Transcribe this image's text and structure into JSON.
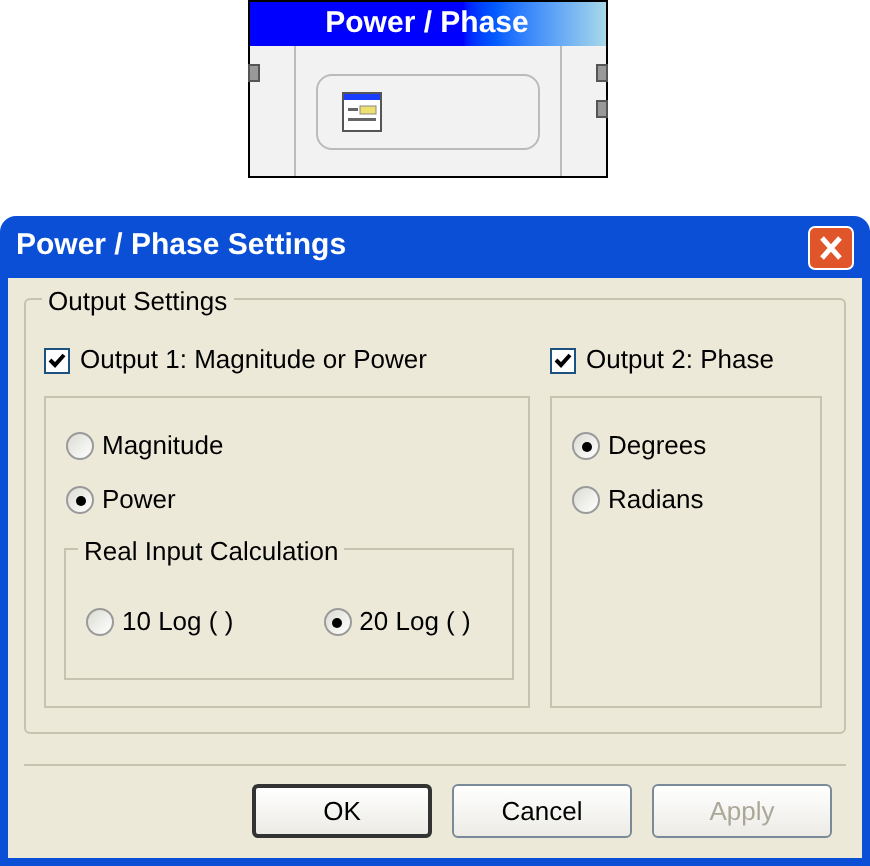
{
  "block": {
    "title": "Power / Phase"
  },
  "dialog": {
    "title": "Power / Phase Settings",
    "output_settings": {
      "legend": "Output Settings",
      "output_1": {
        "label": "Output 1: Magnitude or Power",
        "checked": true,
        "options": [
          {
            "label": "Magnitude",
            "selected": false
          },
          {
            "label": "Power",
            "selected": true
          }
        ],
        "real_input_calculation": {
          "legend": "Real Input Calculation",
          "options": [
            {
              "label": "10 Log ( )",
              "selected": false
            },
            {
              "label": "20 Log ( )",
              "selected": true
            }
          ]
        }
      },
      "output_2": {
        "label": "Output 2: Phase",
        "checked": true,
        "options": [
          {
            "label": "Degrees",
            "selected": true
          },
          {
            "label": "Radians",
            "selected": false
          }
        ]
      }
    },
    "buttons": [
      {
        "label": "OK",
        "default": true,
        "disabled": false
      },
      {
        "label": "Cancel",
        "default": false,
        "disabled": false
      },
      {
        "label": "Apply",
        "default": false,
        "disabled": true
      }
    ]
  }
}
